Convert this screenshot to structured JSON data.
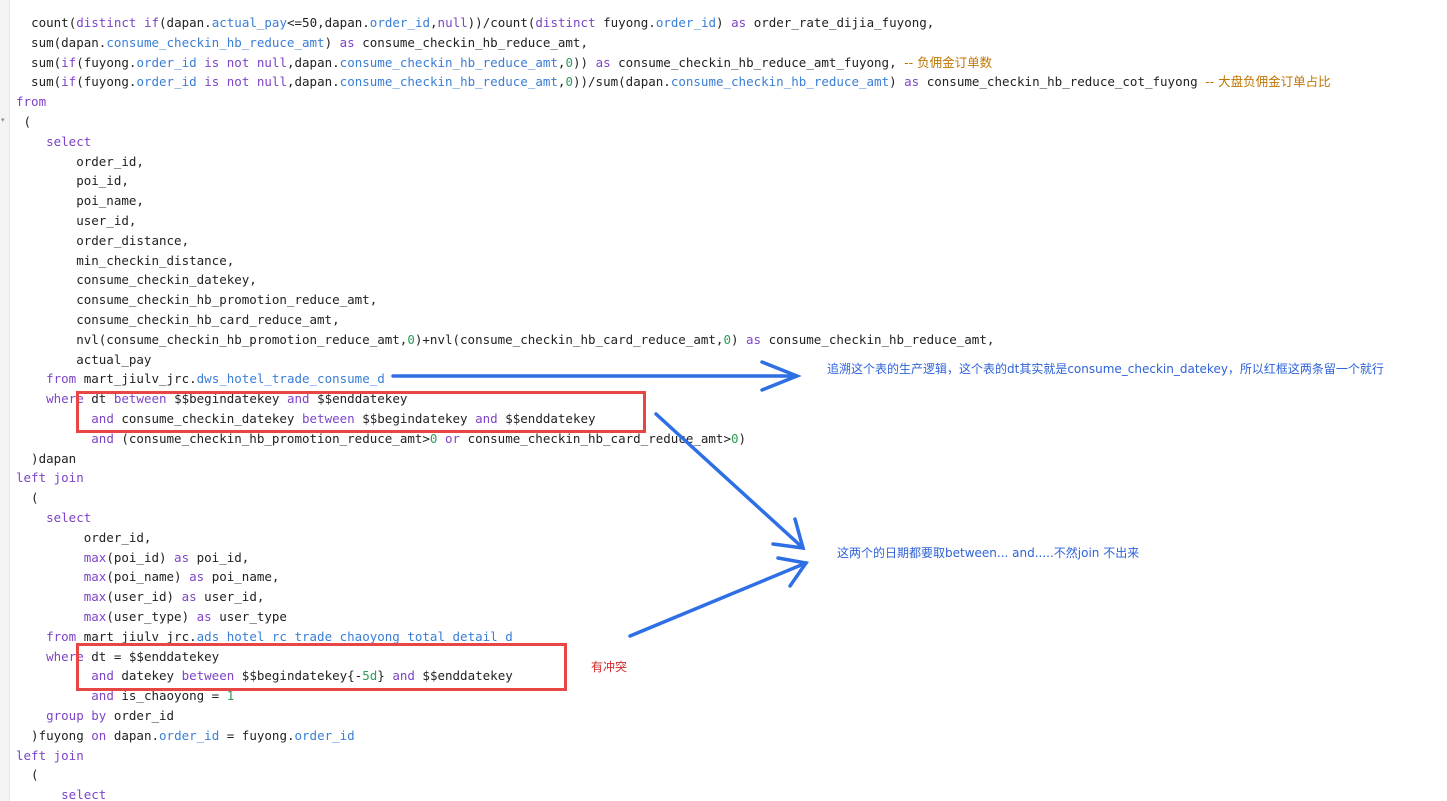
{
  "code_lines": [
    {
      "parts": [
        {
          "t": "  "
        },
        {
          "t": "count(",
          "c": "s"
        },
        {
          "t": "distinct",
          "c": "k"
        },
        {
          "t": " "
        },
        {
          "t": "if",
          "c": "k"
        },
        {
          "t": "(dapan."
        },
        {
          "t": "actual_pay",
          "c": "f"
        },
        {
          "t": "<="
        },
        {
          "t": "50",
          "c": "s"
        },
        {
          "t": ",dapan."
        },
        {
          "t": "order_id",
          "c": "f"
        },
        {
          "t": ","
        },
        {
          "t": "null",
          "c": "k"
        },
        {
          "t": "))/count("
        },
        {
          "t": "distinct",
          "c": "k"
        },
        {
          "t": " fuyong."
        },
        {
          "t": "order_id",
          "c": "f"
        },
        {
          "t": ") "
        },
        {
          "t": "as",
          "c": "k"
        },
        {
          "t": " order_rate_dijia_fuyong,"
        }
      ]
    },
    {
      "parts": [
        {
          "t": "  sum(dapan."
        },
        {
          "t": "consume_checkin_hb_reduce_amt",
          "c": "f"
        },
        {
          "t": ") "
        },
        {
          "t": "as",
          "c": "k"
        },
        {
          "t": " consume_checkin_hb_reduce_amt,"
        }
      ]
    },
    {
      "parts": [
        {
          "t": "  sum("
        },
        {
          "t": "if",
          "c": "k"
        },
        {
          "t": "(fuyong."
        },
        {
          "t": "order_id",
          "c": "f"
        },
        {
          "t": " "
        },
        {
          "t": "is not null",
          "c": "k"
        },
        {
          "t": ",dapan."
        },
        {
          "t": "consume_checkin_hb_reduce_amt",
          "c": "f"
        },
        {
          "t": ","
        },
        {
          "t": "0",
          "c": "n"
        },
        {
          "t": ")) "
        },
        {
          "t": "as",
          "c": "k"
        },
        {
          "t": " consume_checkin_hb_reduce_amt_fuyong, "
        },
        {
          "t": "-- 负佣金订单数",
          "c": "c"
        }
      ]
    },
    {
      "parts": [
        {
          "t": "  sum("
        },
        {
          "t": "if",
          "c": "k"
        },
        {
          "t": "(fuyong."
        },
        {
          "t": "order_id",
          "c": "f"
        },
        {
          "t": " "
        },
        {
          "t": "is not null",
          "c": "k"
        },
        {
          "t": ",dapan."
        },
        {
          "t": "consume_checkin_hb_reduce_amt",
          "c": "f"
        },
        {
          "t": ","
        },
        {
          "t": "0",
          "c": "n"
        },
        {
          "t": "))/sum(dapan."
        },
        {
          "t": "consume_checkin_hb_reduce_amt",
          "c": "f"
        },
        {
          "t": ") "
        },
        {
          "t": "as",
          "c": "k"
        },
        {
          "t": " consume_checkin_hb_reduce_cot_fuyong "
        },
        {
          "t": "-- 大盘负佣金订单占比",
          "c": "c"
        }
      ]
    },
    {
      "parts": [
        {
          "t": "from",
          "c": "k"
        }
      ]
    },
    {
      "parts": [
        {
          "t": " ("
        }
      ]
    },
    {
      "parts": [
        {
          "t": "    "
        },
        {
          "t": "select",
          "c": "k"
        }
      ]
    },
    {
      "parts": [
        {
          "t": "        order_id,"
        }
      ]
    },
    {
      "parts": [
        {
          "t": "        poi_id,"
        }
      ]
    },
    {
      "parts": [
        {
          "t": "        poi_name,"
        }
      ]
    },
    {
      "parts": [
        {
          "t": "        user_id,"
        }
      ]
    },
    {
      "parts": [
        {
          "t": "        order_distance,"
        }
      ]
    },
    {
      "parts": [
        {
          "t": "        min_checkin_distance,"
        }
      ]
    },
    {
      "parts": [
        {
          "t": "        consume_checkin_datekey,"
        }
      ]
    },
    {
      "parts": [
        {
          "t": "        consume_checkin_hb_promotion_reduce_amt,"
        }
      ]
    },
    {
      "parts": [
        {
          "t": "        consume_checkin_hb_card_reduce_amt,"
        }
      ]
    },
    {
      "parts": [
        {
          "t": "        nvl(consume_checkin_hb_promotion_reduce_amt,"
        },
        {
          "t": "0",
          "c": "n"
        },
        {
          "t": ")+nvl(consume_checkin_hb_card_reduce_amt,"
        },
        {
          "t": "0",
          "c": "n"
        },
        {
          "t": ") "
        },
        {
          "t": "as",
          "c": "k"
        },
        {
          "t": " consume_checkin_hb_reduce_amt,"
        }
      ]
    },
    {
      "parts": [
        {
          "t": "        actual_pay"
        }
      ]
    },
    {
      "parts": [
        {
          "t": "    "
        },
        {
          "t": "from",
          "c": "k"
        },
        {
          "t": " mart_jiulv_jrc."
        },
        {
          "t": "dws_hotel_trade_consume_d",
          "c": "f"
        }
      ]
    },
    {
      "parts": [
        {
          "t": "    "
        },
        {
          "t": "where",
          "c": "k"
        },
        {
          "t": " dt "
        },
        {
          "t": "between",
          "c": "k"
        },
        {
          "t": " $$begindatekey "
        },
        {
          "t": "and",
          "c": "k"
        },
        {
          "t": " $$enddatekey"
        }
      ]
    },
    {
      "parts": [
        {
          "t": "          "
        },
        {
          "t": "and",
          "c": "k"
        },
        {
          "t": " consume_checkin_datekey "
        },
        {
          "t": "between",
          "c": "k"
        },
        {
          "t": " $$begindatekey "
        },
        {
          "t": "and",
          "c": "k"
        },
        {
          "t": " $$enddatekey"
        }
      ]
    },
    {
      "parts": [
        {
          "t": "          "
        },
        {
          "t": "and",
          "c": "k"
        },
        {
          "t": " (consume_checkin_hb_promotion_reduce_amt>"
        },
        {
          "t": "0",
          "c": "n"
        },
        {
          "t": " "
        },
        {
          "t": "or",
          "c": "k"
        },
        {
          "t": " consume_checkin_hb_card_reduce_amt>"
        },
        {
          "t": "0",
          "c": "n"
        },
        {
          "t": ")"
        }
      ]
    },
    {
      "parts": [
        {
          "t": "  )dapan"
        }
      ]
    },
    {
      "parts": [
        {
          "t": "left join",
          "c": "k"
        }
      ]
    },
    {
      "parts": [
        {
          "t": "  ("
        }
      ]
    },
    {
      "parts": [
        {
          "t": "    "
        },
        {
          "t": "select",
          "c": "k"
        }
      ]
    },
    {
      "parts": [
        {
          "t": "         order_id,"
        }
      ]
    },
    {
      "parts": [
        {
          "t": "         "
        },
        {
          "t": "max",
          "c": "k"
        },
        {
          "t": "(poi_id) "
        },
        {
          "t": "as",
          "c": "k"
        },
        {
          "t": " poi_id,"
        }
      ]
    },
    {
      "parts": [
        {
          "t": "         "
        },
        {
          "t": "max",
          "c": "k"
        },
        {
          "t": "(poi_name) "
        },
        {
          "t": "as",
          "c": "k"
        },
        {
          "t": " poi_name,"
        }
      ]
    },
    {
      "parts": [
        {
          "t": "         "
        },
        {
          "t": "max",
          "c": "k"
        },
        {
          "t": "(user_id) "
        },
        {
          "t": "as",
          "c": "k"
        },
        {
          "t": " user_id,"
        }
      ]
    },
    {
      "parts": [
        {
          "t": "         "
        },
        {
          "t": "max",
          "c": "k"
        },
        {
          "t": "(user_type) "
        },
        {
          "t": "as",
          "c": "k"
        },
        {
          "t": " user_type"
        }
      ]
    },
    {
      "parts": [
        {
          "t": "    "
        },
        {
          "t": "from",
          "c": "k"
        },
        {
          "t": " mart_jiulv_jrc."
        },
        {
          "t": "ads_hotel_rc_trade_chaoyong_total_detail_d",
          "c": "f"
        }
      ]
    },
    {
      "parts": [
        {
          "t": "    "
        },
        {
          "t": "where",
          "c": "k"
        },
        {
          "t": " dt = $$enddatekey"
        }
      ]
    },
    {
      "parts": [
        {
          "t": "          "
        },
        {
          "t": "and",
          "c": "k"
        },
        {
          "t": " datekey "
        },
        {
          "t": "between",
          "c": "k"
        },
        {
          "t": " $$begindatekey{-"
        },
        {
          "t": "5d",
          "c": "n"
        },
        {
          "t": "} "
        },
        {
          "t": "and",
          "c": "k"
        },
        {
          "t": " $$enddatekey"
        }
      ]
    },
    {
      "parts": [
        {
          "t": "          "
        },
        {
          "t": "and",
          "c": "k"
        },
        {
          "t": " is_chaoyong = "
        },
        {
          "t": "1",
          "c": "n"
        }
      ]
    },
    {
      "parts": [
        {
          "t": "    "
        },
        {
          "t": "group by",
          "c": "k"
        },
        {
          "t": " order_id"
        }
      ]
    },
    {
      "parts": [
        {
          "t": "  )fuyong "
        },
        {
          "t": "on",
          "c": "k"
        },
        {
          "t": " dapan."
        },
        {
          "t": "order_id",
          "c": "f"
        },
        {
          "t": " = fuyong."
        },
        {
          "t": "order_id",
          "c": "f"
        }
      ]
    },
    {
      "parts": [
        {
          "t": "left join",
          "c": "k"
        }
      ]
    },
    {
      "parts": [
        {
          "t": "  ("
        }
      ]
    },
    {
      "parts": [
        {
          "t": "      "
        },
        {
          "t": "select",
          "c": "k"
        }
      ]
    }
  ],
  "annotations": {
    "note_1": "追溯这个表的生产逻辑，这个表的dt其实就是consume_checkin_datekey，所以红框这两条留一个就行",
    "note_2": "这两个的日期都要取between... and.....不然join 不出来",
    "note_3": "有冲突"
  },
  "colors": {
    "keyword": "#7d44c7",
    "field": "#3a7ed6",
    "number": "#2d9c58",
    "comment": "#c07600",
    "box": "#e84545",
    "arrow": "#2f6fe6",
    "note_blue": "#2f63d9",
    "note_red": "#d22a2a"
  }
}
